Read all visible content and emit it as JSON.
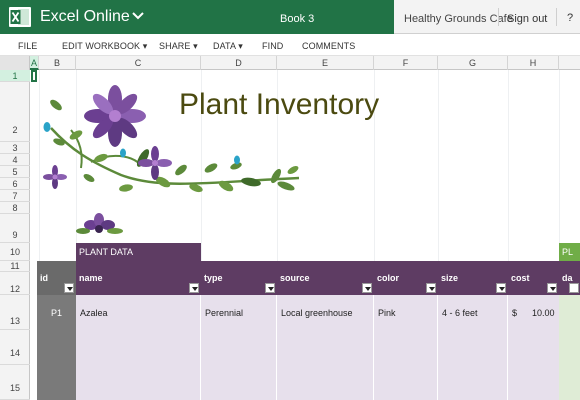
{
  "app": {
    "name": "Excel Online",
    "book": "Book 3",
    "user": "Healthy Grounds Cafe",
    "signout": "Sign out",
    "help": "?"
  },
  "ribbon": {
    "file": "FILE",
    "edit": "EDIT WORKBOOK",
    "share": "SHARE",
    "data": "DATA",
    "find": "FIND",
    "comments": "COMMENTS"
  },
  "columns": [
    "A",
    "B",
    "C",
    "D",
    "E",
    "F",
    "G",
    "H"
  ],
  "rows": [
    "1",
    "2",
    "3",
    "4",
    "5",
    "6",
    "7",
    "8",
    "9",
    "10",
    "11",
    "12",
    "13",
    "14",
    "15"
  ],
  "sheet": {
    "title": "Plant Inventory",
    "section_label": "PLANT DATA",
    "headers": {
      "id": "id",
      "name": "name",
      "type": "type",
      "source": "source",
      "color": "color",
      "size": "size",
      "cost": "cost",
      "extra": "da"
    },
    "row1": {
      "id": "P1",
      "name": "Azalea",
      "type": "Perennial",
      "source": "Local greenhouse",
      "color": "Pink",
      "size": "4 - 6 feet",
      "cost_symbol": "$",
      "cost": "10.00"
    },
    "stub_label": "PL"
  },
  "colors": {
    "excel_green": "#217346",
    "header_purple": "#5e3c63",
    "row_lavender": "#e7e0ec",
    "title_olive": "#4b4a10",
    "accent_green": "#70ad47"
  }
}
